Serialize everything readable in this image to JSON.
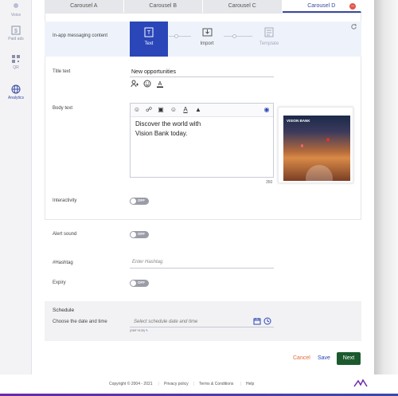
{
  "sidebar": {
    "items": [
      {
        "label": "Voice",
        "icon": "voice-icon"
      },
      {
        "label": "Paid ads",
        "icon": "paid-ads-icon"
      },
      {
        "label": "QR",
        "icon": "qr-code-icon"
      },
      {
        "label": "Analytics",
        "icon": "globe-icon"
      }
    ]
  },
  "tabs": [
    "Carousel A",
    "Carousel B",
    "Carousel C",
    "Carousel D"
  ],
  "active_tab": "Carousel D",
  "content": {
    "in_app_label": "In-app messaging content",
    "steps": [
      "Text",
      "Import",
      "Template"
    ],
    "title_label": "Title text",
    "title_value": "New opportunities",
    "body_label": "Body text",
    "body_value_line1": "Discover the world with",
    "body_value_line2": "Vision Bank today.",
    "char_count": "350",
    "preview_brand": "VISION BANK",
    "interactivity_label": "Interactivity",
    "toggle_off": "OFF"
  },
  "settings": {
    "alert_label": "Alert sound",
    "hashtag_label": "#Hashtag",
    "hashtag_placeholder": "Enter Hashtag",
    "expiry_label": "Expiry",
    "schedule_title": "Schedule",
    "schedule_label": "Choose the date and time",
    "schedule_placeholder": "Select schedule date and time",
    "timezone": "(GMT+5:30)"
  },
  "actions": {
    "cancel": "Cancel",
    "save": "Save",
    "next": "Next"
  },
  "footer": {
    "copyright": "Copyright © 2004 - 2021",
    "privacy": "Privacy policy",
    "terms": "Terms & Conditions",
    "help": "Help"
  },
  "colors": {
    "primary": "#2a46b8",
    "next_button": "#1c5a2e",
    "cancel": "#e06a3a",
    "delete": "#e2574c"
  }
}
